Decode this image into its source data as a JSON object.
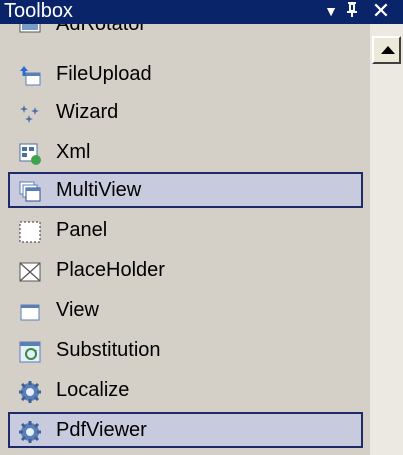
{
  "window": {
    "title": "Toolbox",
    "buttons": {
      "dropdown": "▾",
      "pin": "ᵖ",
      "close": "×"
    }
  },
  "items": [
    {
      "label": "AdRotator",
      "icon": "adrotator-icon",
      "selected": false
    },
    {
      "label": "FileUpload",
      "icon": "fileupload-icon",
      "selected": false
    },
    {
      "label": "Wizard",
      "icon": "wizard-icon",
      "selected": false
    },
    {
      "label": "Xml",
      "icon": "xml-icon",
      "selected": false
    },
    {
      "label": "MultiView",
      "icon": "multiview-icon",
      "selected": true
    },
    {
      "label": "Panel",
      "icon": "panel-icon",
      "selected": false
    },
    {
      "label": "PlaceHolder",
      "icon": "placeholder-icon",
      "selected": false
    },
    {
      "label": "View",
      "icon": "view-icon",
      "selected": false
    },
    {
      "label": "Substitution",
      "icon": "substitution-icon",
      "selected": false
    },
    {
      "label": "Localize",
      "icon": "localize-icon",
      "selected": false
    },
    {
      "label": "PdfViewer",
      "icon": "pdfviewer-icon",
      "selected": true
    }
  ],
  "colors": {
    "titlebar": "#0a246a",
    "panel": "#d4d0c8",
    "selection": "#c8cbdd",
    "selection_border": "#1f2a6b"
  }
}
